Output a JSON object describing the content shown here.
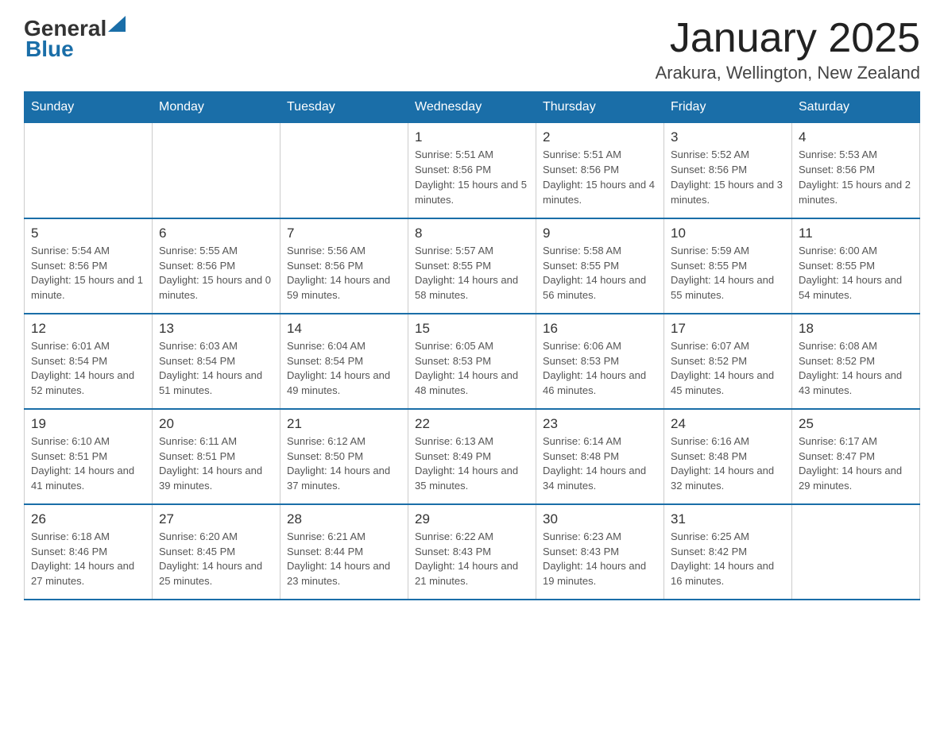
{
  "header": {
    "logo_general": "General",
    "logo_blue": "Blue",
    "title": "January 2025",
    "subtitle": "Arakura, Wellington, New Zealand"
  },
  "days_of_week": [
    "Sunday",
    "Monday",
    "Tuesday",
    "Wednesday",
    "Thursday",
    "Friday",
    "Saturday"
  ],
  "weeks": [
    [
      {
        "num": "",
        "info": ""
      },
      {
        "num": "",
        "info": ""
      },
      {
        "num": "",
        "info": ""
      },
      {
        "num": "1",
        "info": "Sunrise: 5:51 AM\nSunset: 8:56 PM\nDaylight: 15 hours\nand 5 minutes."
      },
      {
        "num": "2",
        "info": "Sunrise: 5:51 AM\nSunset: 8:56 PM\nDaylight: 15 hours\nand 4 minutes."
      },
      {
        "num": "3",
        "info": "Sunrise: 5:52 AM\nSunset: 8:56 PM\nDaylight: 15 hours\nand 3 minutes."
      },
      {
        "num": "4",
        "info": "Sunrise: 5:53 AM\nSunset: 8:56 PM\nDaylight: 15 hours\nand 2 minutes."
      }
    ],
    [
      {
        "num": "5",
        "info": "Sunrise: 5:54 AM\nSunset: 8:56 PM\nDaylight: 15 hours\nand 1 minute."
      },
      {
        "num": "6",
        "info": "Sunrise: 5:55 AM\nSunset: 8:56 PM\nDaylight: 15 hours\nand 0 minutes."
      },
      {
        "num": "7",
        "info": "Sunrise: 5:56 AM\nSunset: 8:56 PM\nDaylight: 14 hours\nand 59 minutes."
      },
      {
        "num": "8",
        "info": "Sunrise: 5:57 AM\nSunset: 8:55 PM\nDaylight: 14 hours\nand 58 minutes."
      },
      {
        "num": "9",
        "info": "Sunrise: 5:58 AM\nSunset: 8:55 PM\nDaylight: 14 hours\nand 56 minutes."
      },
      {
        "num": "10",
        "info": "Sunrise: 5:59 AM\nSunset: 8:55 PM\nDaylight: 14 hours\nand 55 minutes."
      },
      {
        "num": "11",
        "info": "Sunrise: 6:00 AM\nSunset: 8:55 PM\nDaylight: 14 hours\nand 54 minutes."
      }
    ],
    [
      {
        "num": "12",
        "info": "Sunrise: 6:01 AM\nSunset: 8:54 PM\nDaylight: 14 hours\nand 52 minutes."
      },
      {
        "num": "13",
        "info": "Sunrise: 6:03 AM\nSunset: 8:54 PM\nDaylight: 14 hours\nand 51 minutes."
      },
      {
        "num": "14",
        "info": "Sunrise: 6:04 AM\nSunset: 8:54 PM\nDaylight: 14 hours\nand 49 minutes."
      },
      {
        "num": "15",
        "info": "Sunrise: 6:05 AM\nSunset: 8:53 PM\nDaylight: 14 hours\nand 48 minutes."
      },
      {
        "num": "16",
        "info": "Sunrise: 6:06 AM\nSunset: 8:53 PM\nDaylight: 14 hours\nand 46 minutes."
      },
      {
        "num": "17",
        "info": "Sunrise: 6:07 AM\nSunset: 8:52 PM\nDaylight: 14 hours\nand 45 minutes."
      },
      {
        "num": "18",
        "info": "Sunrise: 6:08 AM\nSunset: 8:52 PM\nDaylight: 14 hours\nand 43 minutes."
      }
    ],
    [
      {
        "num": "19",
        "info": "Sunrise: 6:10 AM\nSunset: 8:51 PM\nDaylight: 14 hours\nand 41 minutes."
      },
      {
        "num": "20",
        "info": "Sunrise: 6:11 AM\nSunset: 8:51 PM\nDaylight: 14 hours\nand 39 minutes."
      },
      {
        "num": "21",
        "info": "Sunrise: 6:12 AM\nSunset: 8:50 PM\nDaylight: 14 hours\nand 37 minutes."
      },
      {
        "num": "22",
        "info": "Sunrise: 6:13 AM\nSunset: 8:49 PM\nDaylight: 14 hours\nand 35 minutes."
      },
      {
        "num": "23",
        "info": "Sunrise: 6:14 AM\nSunset: 8:48 PM\nDaylight: 14 hours\nand 34 minutes."
      },
      {
        "num": "24",
        "info": "Sunrise: 6:16 AM\nSunset: 8:48 PM\nDaylight: 14 hours\nand 32 minutes."
      },
      {
        "num": "25",
        "info": "Sunrise: 6:17 AM\nSunset: 8:47 PM\nDaylight: 14 hours\nand 29 minutes."
      }
    ],
    [
      {
        "num": "26",
        "info": "Sunrise: 6:18 AM\nSunset: 8:46 PM\nDaylight: 14 hours\nand 27 minutes."
      },
      {
        "num": "27",
        "info": "Sunrise: 6:20 AM\nSunset: 8:45 PM\nDaylight: 14 hours\nand 25 minutes."
      },
      {
        "num": "28",
        "info": "Sunrise: 6:21 AM\nSunset: 8:44 PM\nDaylight: 14 hours\nand 23 minutes."
      },
      {
        "num": "29",
        "info": "Sunrise: 6:22 AM\nSunset: 8:43 PM\nDaylight: 14 hours\nand 21 minutes."
      },
      {
        "num": "30",
        "info": "Sunrise: 6:23 AM\nSunset: 8:43 PM\nDaylight: 14 hours\nand 19 minutes."
      },
      {
        "num": "31",
        "info": "Sunrise: 6:25 AM\nSunset: 8:42 PM\nDaylight: 14 hours\nand 16 minutes."
      },
      {
        "num": "",
        "info": ""
      }
    ]
  ]
}
